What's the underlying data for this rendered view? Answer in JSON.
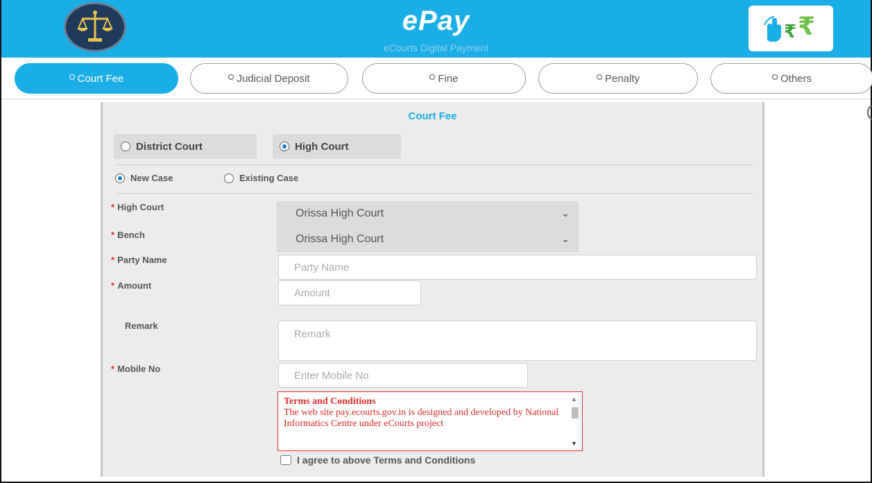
{
  "header": {
    "title": "ePay",
    "subtitle": "eCourts Digital Payment",
    "colors": {
      "primary": "#1aaee6",
      "white": "#ffffff"
    }
  },
  "tabs": [
    {
      "label": "Court Fee",
      "active": true
    },
    {
      "label": "Judicial Deposit",
      "active": false
    },
    {
      "label": "Fine",
      "active": false
    },
    {
      "label": "Penalty",
      "active": false
    },
    {
      "label": "Others",
      "active": false
    }
  ],
  "form": {
    "title": "Court Fee",
    "court_types": [
      {
        "label": "District Court",
        "selected": false
      },
      {
        "label": "High Court",
        "selected": true
      }
    ],
    "case_types": [
      {
        "label": "New Case",
        "selected": true
      },
      {
        "label": "Existing Case",
        "selected": false
      }
    ],
    "fields": {
      "high_court": {
        "label": "High Court",
        "value": "Orissa High Court",
        "required": "*"
      },
      "bench": {
        "label": "Bench",
        "value": "Orissa High Court",
        "required": "*"
      },
      "party_name": {
        "label": "Party Name",
        "placeholder": "Party Name",
        "required": "*"
      },
      "amount": {
        "label": "Amount",
        "placeholder": "Amount",
        "required": "*"
      },
      "remark": {
        "label": "Remark",
        "placeholder": "Remark"
      },
      "mobile": {
        "label": "Mobile No",
        "placeholder": "Enter Mobile No",
        "required": "*"
      }
    },
    "terms": {
      "heading": "Terms and Conditions",
      "text": "The web site pay.ecourts.gov.in is designed and developed by National Informatics Centre under eCourts project"
    },
    "agree_label": "I agree to above Terms and Conditions"
  }
}
